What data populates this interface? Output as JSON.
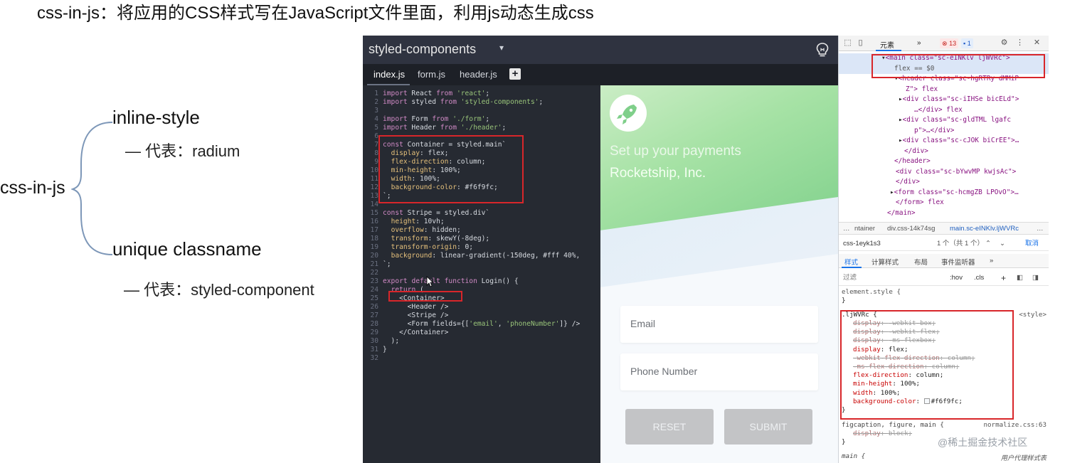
{
  "slide": {
    "title": "css-in-js：将应用的CSS样式写在JavaScript文件里面，利用js动态生成css",
    "root": "css-in-js",
    "branch1": "inline-style",
    "branch1_sub": "— 代表：radium",
    "branch2": "unique classname",
    "branch2_sub": "— 代表：styled-component"
  },
  "editor": {
    "title": "styled-components",
    "tabs": [
      "index.js",
      "form.js",
      "header.js"
    ],
    "code_lines": [
      "import React from 'react';",
      "import styled from 'styled-components';",
      "",
      "import Form from './form';",
      "import Header from './header';",
      "",
      "const Container = styled.main`",
      "  display: flex;",
      "  flex-direction: column;",
      "  min-height: 100%;",
      "  width: 100%;",
      "  background-color: #f6f9fc;",
      "`;",
      "",
      "const Stripe = styled.div`",
      "  height: 10vh;",
      "  overflow: hidden;",
      "  transform: skewY(-8deg);",
      "  transform-origin: 0;",
      "  background: linear-gradient(-150deg, #fff 40%,",
      "`;",
      "",
      "export default function Login() {",
      "  return (",
      "    <Container>",
      "      <Header />",
      "      <Stripe />",
      "      <Form fields={['email', 'phoneNumber']} />",
      "    </Container>",
      "  );",
      "}",
      ""
    ]
  },
  "preview": {
    "line1": "Set up your payments",
    "line2": "Rocketship, Inc.",
    "email_placeholder": "Email",
    "phone_placeholder": "Phone Number",
    "reset": "RESET",
    "submit": "SUBMIT"
  },
  "devtools": {
    "tab_elements": "元素",
    "more": "»",
    "errors": "13",
    "messages": "1",
    "dom": [
      "<main class=\"sc-eINKlv ljWVRc\">",
      "flex == $0",
      "<header class=\"sc-hgRTRy dMMiP",
      "Z\"> flex",
      "<div class=\"sc-iIHSe bicELd\">",
      "…</div> flex",
      "<div class=\"sc-gldTML lgafc",
      "p\">…</div>",
      "<div class=\"sc-cJOK biCrEE\">…",
      "</div>",
      "</header>",
      "<div class=\"sc-bYwvMP kwjsAc\">",
      "</div>",
      "<form class=\"sc-hcmgZB LPOvO\">…",
      "</form> flex",
      "</main>"
    ],
    "crumbs": [
      "…",
      "ntainer",
      "div.css-14k74sg",
      "main.sc-eINKlv.ljWVRc",
      "…"
    ],
    "search_value": "css-1eyk1s3",
    "search_count": "1 个（共 1 个）",
    "search_cancel": "取消",
    "style_tabs": [
      "样式",
      "计算样式",
      "布局",
      "事件监听器",
      "»"
    ],
    "filter_placeholder": "过滤",
    "filter_hov": ":hov",
    "filter_cls": ".cls",
    "filter_plus": "+",
    "element_style": "element.style {",
    "close_brace": "}",
    "rule_selector": ".ljWVRc {",
    "rule_source": "<style>",
    "rule_lines": [
      {
        "prop": "display",
        "value": "-webkit-box;",
        "struck": true
      },
      {
        "prop": "display",
        "value": "-webkit-flex;",
        "struck": true
      },
      {
        "prop": "display",
        "value": "-ms-flexbox;",
        "struck": true
      },
      {
        "prop": "display",
        "value": "flex;",
        "struck": false
      },
      {
        "prop": "-webkit-flex-direction",
        "value": "column;",
        "struck": true
      },
      {
        "prop": "-ms-flex-direction",
        "value": "column;",
        "struck": true
      },
      {
        "prop": "flex-direction",
        "value": "column;",
        "struck": false
      },
      {
        "prop": "min-height",
        "value": "100%;",
        "struck": false
      },
      {
        "prop": "width",
        "value": "100%;",
        "struck": false
      },
      {
        "prop": "background-color",
        "value": "#f6f9fc;",
        "struck": false
      }
    ],
    "rule2_selector": "figcaption, figure, main {",
    "rule2_source": "normalize.css:63",
    "rule2_line": {
      "prop": "display",
      "value": "block;"
    },
    "rule3_selector": "main {",
    "rule3_source": "用户代理样式表"
  },
  "watermark": "@稀土掘金技术社区",
  "colors": {
    "highlight": "#d8262a",
    "editor_bg": "#262a32",
    "preview_bg": "#f6f9fc"
  }
}
